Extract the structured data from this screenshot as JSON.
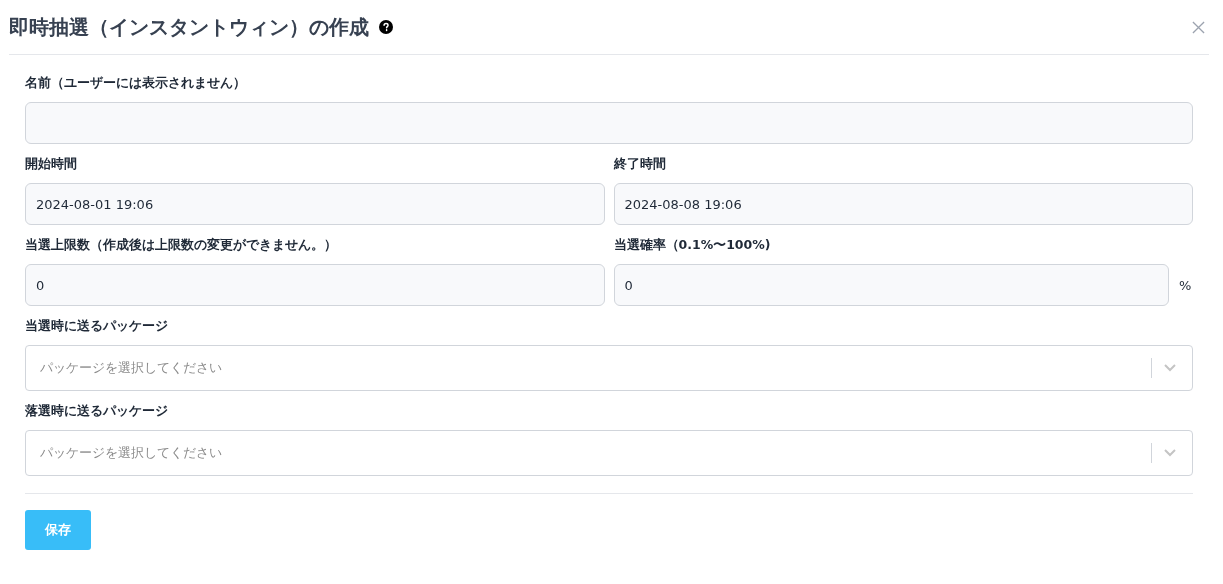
{
  "dialog": {
    "title": "即時抽選（インスタントウィン）の作成"
  },
  "rows": [
    [
      {
        "kind": "text",
        "label": "名前（ユーザーには表示されません）"
      }
    ],
    [
      {
        "kind": "text",
        "label": "開始時間",
        "value": "2024-08-01 19:06"
      },
      {
        "kind": "text",
        "label": "終了時間",
        "value": "2024-08-08 19:06"
      }
    ],
    [
      {
        "kind": "text",
        "label": "当選上限数（作成後は上限数の変更ができません。）",
        "value": "0"
      },
      {
        "kind": "text",
        "label": "当選確率（0.1%〜100%)",
        "value": "0",
        "suffix": "%"
      }
    ],
    [
      {
        "kind": "select",
        "label": "当選時に送るパッケージ",
        "placeholder": "パッケージを選択してください"
      }
    ],
    [
      {
        "kind": "select",
        "label": "落選時に送るパッケージ",
        "placeholder": "パッケージを選択してください"
      }
    ]
  ],
  "buttons": [
    {
      "label": "保存",
      "kind": "primary"
    }
  ]
}
